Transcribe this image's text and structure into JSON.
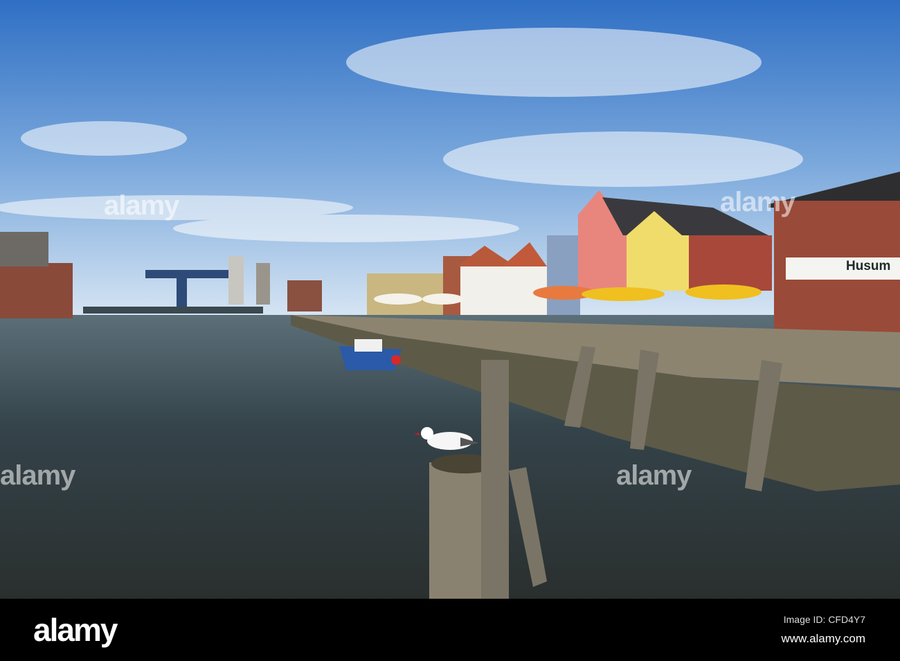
{
  "photo": {
    "sign_text": "Husum",
    "watermark": "alamy",
    "colors": {
      "sky_top": "#2f6fc4",
      "sky_bottom": "#d6e6f5",
      "water": "#2d3a3c",
      "quay": "#8d8470"
    }
  },
  "footer": {
    "logo": "alamy",
    "image_id": "Image ID: CFD4Y7",
    "website": "www.alamy.com"
  }
}
